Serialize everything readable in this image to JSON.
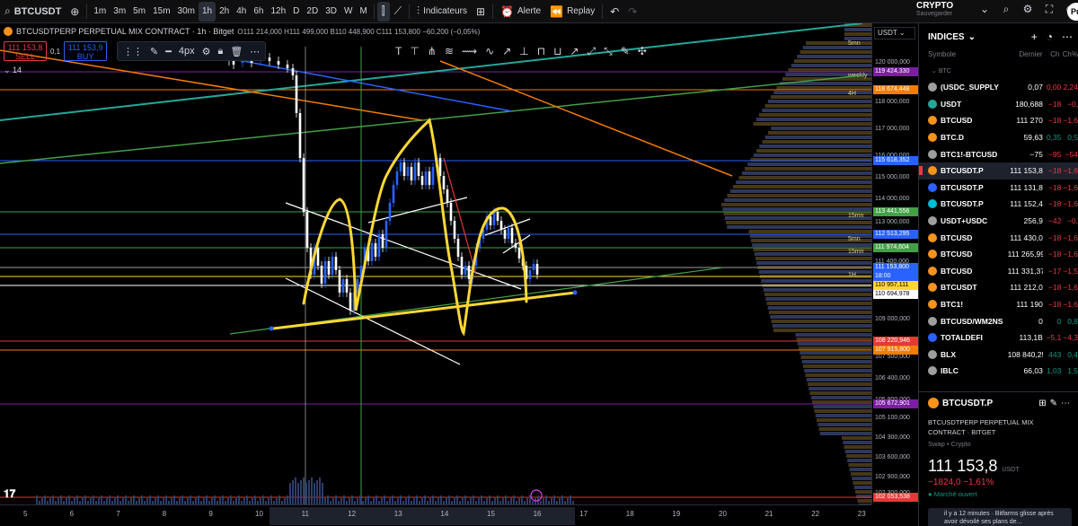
{
  "toolbar": {
    "symbol": "BTCUSDT",
    "intervals": [
      "1m",
      "3m",
      "5m",
      "15m",
      "30m",
      "1h",
      "2h",
      "4h",
      "6h",
      "12h",
      "D",
      "2D",
      "3D",
      "W",
      "M"
    ],
    "active_interval": "1h",
    "indicators_label": "Indicateurs",
    "alert_label": "Alerte",
    "replay_label": "Replay"
  },
  "account": {
    "market": "CRYPTO",
    "status": "Sauvegarder",
    "publish_label": "Pu"
  },
  "legend": {
    "title": "BTCUSDTPERP PERPETUAL MIX CONTRACT · 1h · Bitget",
    "ohlc": "O111 214,000 H111 499,000 B110 448,900 C111 153,800 −60,200 (−0,05%)",
    "sell_price": "111 153,8",
    "sell_label": "SELL",
    "spread": "0,1",
    "buy_price": "111 153,9",
    "buy_label": "BUY",
    "indicator_count": "14"
  },
  "drawbar": {
    "width_label": "4px"
  },
  "price_axis": {
    "currency": "USDT",
    "ticks": [
      "120 000,000",
      "118 000,000",
      "117 000,000",
      "116 000,000",
      "115 000,000",
      "114 000,000",
      "113 000,000",
      "111 400,000",
      "109 000,000",
      "107 500,000",
      "106 400,000",
      "105 900,000",
      "105 100,000",
      "104 300,000",
      "103 600,000",
      "102 900,000",
      "102 300,000"
    ],
    "badges": [
      {
        "value": "119 424,330",
        "color": "#7b1fa2"
      },
      {
        "value": "118 674,448",
        "color": "#f57c00"
      },
      {
        "value": "115 618,352",
        "color": "#2962ff"
      },
      {
        "value": "113 441,556",
        "color": "#43a047"
      },
      {
        "value": "112 513,295",
        "color": "#2962ff"
      },
      {
        "value": "111 974,604",
        "color": "#43a047"
      },
      {
        "value": "111 153,800",
        "color": "#2962ff"
      },
      {
        "value": "18:00",
        "color": "#2962ff"
      },
      {
        "value": "110 957,111",
        "color": "#fdd835"
      },
      {
        "value": "110 694,978",
        "color": "#ffffff"
      },
      {
        "value": "108 220,946",
        "color": "#e53935"
      },
      {
        "value": "107 915,800",
        "color": "#f57c00"
      },
      {
        "value": "105 672,901",
        "color": "#7b1fa2"
      },
      {
        "value": "102 053,538",
        "color": "#e53935"
      }
    ],
    "tf_labels": [
      "5mn",
      "weekly",
      "4H",
      "15mn",
      "5mn",
      "15mn",
      "1H"
    ]
  },
  "time_axis": {
    "ticks": [
      "5",
      "6",
      "7",
      "8",
      "9",
      "10",
      "11",
      "12",
      "13",
      "14",
      "15",
      "16",
      "17",
      "18",
      "19",
      "20",
      "21",
      "22",
      "23"
    ]
  },
  "watchlist": {
    "title": "INDICES",
    "columns": [
      "Symbole",
      "Dernier",
      "Ch",
      "Ch%"
    ],
    "group": "BTC",
    "rows": [
      {
        "sym": "(USDC_SUPPLY",
        "last": "0,07",
        "chg": "0,00",
        "chgp": "2,24",
        "dir": "neg",
        "color": "#9e9e9e"
      },
      {
        "sym": "USDT",
        "last": "180,688",
        "chg": "−18",
        "chgp": "−0,",
        "dir": "neg",
        "color": "#26a69a"
      },
      {
        "sym": "BTCUSD",
        "last": "111 270",
        "chg": "−18",
        "chgp": "−1,6",
        "dir": "neg",
        "color": "#f7931a"
      },
      {
        "sym": "BTC.D",
        "last": "59,63",
        "chg": "0,35",
        "chgp": "0,5",
        "dir": "pos",
        "color": "#f7931a"
      },
      {
        "sym": "BTC1!-BTCUSD",
        "last": "−75",
        "chg": "−95",
        "chgp": "−54",
        "dir": "neg",
        "color": "#9e9e9e"
      },
      {
        "sym": "BTCUSDT.P",
        "last": "111 153,8",
        "chg": "−18",
        "chgp": "−1,6",
        "dir": "neg",
        "color": "#f7931a",
        "selected": true
      },
      {
        "sym": "BTCUSDT.P",
        "last": "111 131,8",
        "chg": "−18",
        "chgp": "−1,6",
        "dir": "neg",
        "color": "#2962ff"
      },
      {
        "sym": "BTCUSDT.P",
        "last": "111 152,4",
        "chg": "−18",
        "chgp": "−1,6",
        "dir": "neg",
        "color": "#00bcd4"
      },
      {
        "sym": "USDT+USDC",
        "last": "256,9",
        "chg": "−42",
        "chgp": "−0,",
        "dir": "neg",
        "color": "#9e9e9e"
      },
      {
        "sym": "BTCUSD",
        "last": "111 430,0",
        "chg": "−18",
        "chgp": "−1,6",
        "dir": "neg",
        "color": "#f7931a"
      },
      {
        "sym": "BTCUSD",
        "last": "111 265,99",
        "chg": "−18",
        "chgp": "−1,6",
        "dir": "neg",
        "color": "#f7931a"
      },
      {
        "sym": "BTCUSD",
        "last": "111 331,37",
        "chg": "−17",
        "chgp": "−1,5",
        "dir": "neg",
        "color": "#f7931a"
      },
      {
        "sym": "BTCUSDT",
        "last": "111 212,0",
        "chg": "−18",
        "chgp": "−1,6",
        "dir": "neg",
        "color": "#f7931a"
      },
      {
        "sym": "BTC1!",
        "last": "111 190",
        "chg": "−18",
        "chgp": "−1,6",
        "dir": "neg",
        "color": "#f7931a"
      },
      {
        "sym": "BTCUSD/WM2NS",
        "last": "0",
        "chg": "0",
        "chgp": "0,8",
        "dir": "pos",
        "color": "#9e9e9e"
      },
      {
        "sym": "TOTALDEFI",
        "last": "113,1B",
        "chg": "−5,1",
        "chgp": "−4,3",
        "dir": "neg",
        "color": "#2962ff"
      },
      {
        "sym": "BLX",
        "last": "108 840,25",
        "chg": "443",
        "chgp": "0,4",
        "dir": "pos",
        "color": "#9e9e9e"
      },
      {
        "sym": "IBLC",
        "last": "66,03",
        "chg": "1,03",
        "chgp": "1,5",
        "dir": "pos",
        "color": "#9e9e9e"
      }
    ]
  },
  "detail": {
    "symbol": "BTCUSDT.P",
    "fullname": "BTCUSDTPERP PERPETUAL MIX CONTRACT · BITGET",
    "type": "Swap • Crypto",
    "price": "111 153,8",
    "currency": "USDT",
    "change": "−1824,0  −1,61%",
    "market_status": "Marché ouvert",
    "news": "il y a 12 minutes · Bitfarms glisse après avoir dévoilé ses plans de..."
  }
}
